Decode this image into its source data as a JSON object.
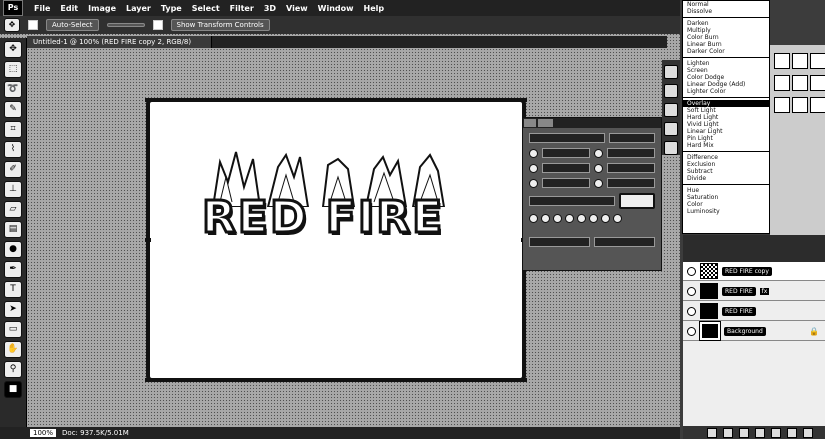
{
  "app": {
    "logo": "Ps"
  },
  "menubar": {
    "items": [
      "File",
      "Edit",
      "Image",
      "Layer",
      "Type",
      "Select",
      "Filter",
      "3D",
      "View",
      "Window",
      "Help"
    ]
  },
  "options_bar": {
    "auto_select": "Auto-Select",
    "show_transform_controls": "Show Transform Controls"
  },
  "document": {
    "tab_title": "Untitled-1 @ 100% (RED FIRE copy 2, RGB/8)",
    "canvas_text": "RED FIRE",
    "zoom": "100%",
    "status_info": "Doc: 937.5K/5.01M"
  },
  "blend_modes": {
    "groups": [
      [
        "Normal",
        "Dissolve"
      ],
      [
        "Darken",
        "Multiply",
        "Color Burn",
        "Linear Burn",
        "Darker Color"
      ],
      [
        "Lighten",
        "Screen",
        "Color Dodge",
        "Linear Dodge (Add)",
        "Lighter Color"
      ],
      [
        "Overlay",
        "Soft Light",
        "Hard Light",
        "Vivid Light",
        "Linear Light",
        "Pin Light",
        "Hard Mix"
      ],
      [
        "Difference",
        "Exclusion",
        "Subtract",
        "Divide"
      ],
      [
        "Hue",
        "Saturation",
        "Color",
        "Luminosity"
      ]
    ],
    "selected": "Overlay"
  },
  "layers": [
    {
      "name": "RED FIRE copy",
      "fx": "",
      "thumb": "checker",
      "selected": true
    },
    {
      "name": "RED FIRE",
      "fx": "fx",
      "thumb": "text",
      "selected": false
    },
    {
      "name": "RED FIRE",
      "fx": "",
      "thumb": "text",
      "selected": false
    },
    {
      "name": "Background",
      "fx": "",
      "thumb": "fill",
      "selected": false
    }
  ],
  "colors": {
    "canvas_bg": "#ffffff",
    "ui_dark": "#2a2a2a",
    "selection": "#000000"
  },
  "icons": [
    "move-tool-icon",
    "marquee-tool-icon",
    "lasso-tool-icon",
    "quick-select-icon",
    "crop-tool-icon",
    "eyedropper-icon",
    "brush-tool-icon",
    "clone-stamp-icon",
    "eraser-icon",
    "gradient-tool-icon",
    "dodge-tool-icon",
    "pen-tool-icon",
    "type-tool-icon",
    "path-select-icon",
    "shape-tool-icon",
    "hand-tool-icon",
    "zoom-tool-icon"
  ]
}
